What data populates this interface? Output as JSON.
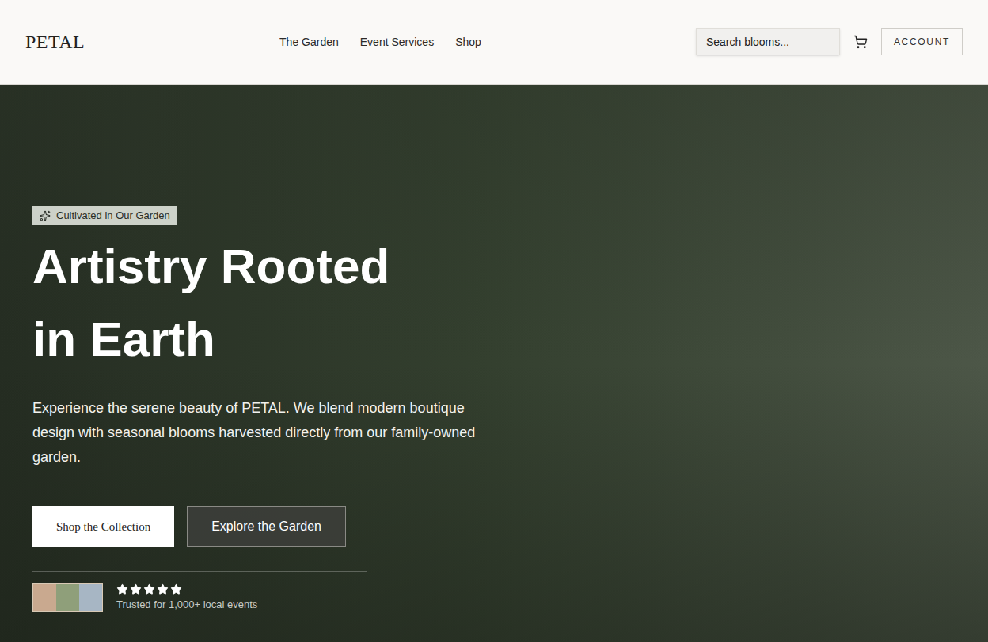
{
  "header": {
    "logo": "PETAL",
    "nav": [
      {
        "label": "The Garden"
      },
      {
        "label": "Event Services"
      },
      {
        "label": "Shop"
      }
    ],
    "search": {
      "placeholder": "Search blooms..."
    },
    "account": "ACCOUNT"
  },
  "hero": {
    "badge": "Cultivated in Our Garden",
    "heading_lines": [
      "Artistry Rooted",
      "in Earth"
    ],
    "description": "Experience the serene beauty of PETAL. We blend modern boutique design with seasonal blooms harvested directly from our family-owned garden.",
    "buttons": [
      {
        "label": "Shop the Collection",
        "kind": "primary"
      },
      {
        "label": "Explore the Garden",
        "kind": "secondary"
      }
    ],
    "social_proof": {
      "stars": 5,
      "text": "Trusted for 1,000+ local events"
    }
  }
}
